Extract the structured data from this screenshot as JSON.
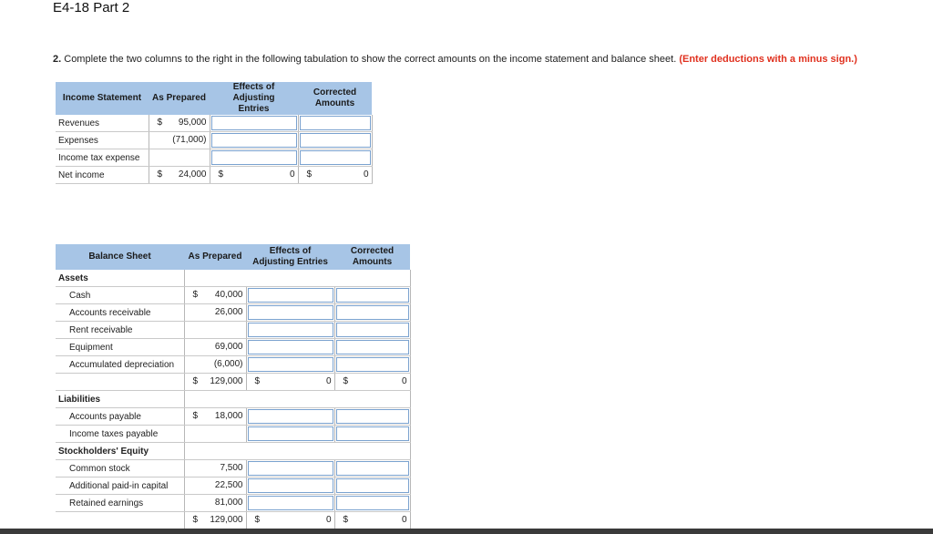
{
  "header": {
    "title": "E4-18 Part 2"
  },
  "instructions": {
    "number": "2.",
    "text": "Complete the two columns to the right in the following tabulation to show the correct amounts on the income statement and balance sheet.",
    "note": "(Enter deductions with a minus sign.)"
  },
  "income_statement": {
    "headers": [
      "Income Statement",
      "As Prepared",
      "Effects of Adjusting Entries",
      "Corrected Amounts"
    ],
    "rows": [
      {
        "label": "Revenues",
        "dollar": "$",
        "amount": "95,000"
      },
      {
        "label": "Expenses",
        "dollar": "",
        "amount": "(71,000)"
      },
      {
        "label": "Income tax expense",
        "dollar": "",
        "amount": ""
      }
    ],
    "total": {
      "label": "Net income",
      "dollar": "$",
      "amount": "24,000",
      "effects_dollar": "$",
      "effects_value": "0",
      "corrected_dollar": "$",
      "corrected_value": "0"
    }
  },
  "balance_sheet": {
    "headers": [
      "Balance Sheet",
      "As Prepared",
      "Effects of Adjusting Entries",
      "Corrected Amounts"
    ],
    "assets_label": "Assets",
    "assets": [
      {
        "label": "Cash",
        "dollar": "$",
        "amount": "40,000"
      },
      {
        "label": "Accounts receivable",
        "dollar": "",
        "amount": "26,000"
      },
      {
        "label": "Rent receivable",
        "dollar": "",
        "amount": ""
      },
      {
        "label": "Equipment",
        "dollar": "",
        "amount": "69,000"
      },
      {
        "label": "Accumulated depreciation",
        "dollar": "",
        "amount": "(6,000)"
      }
    ],
    "assets_total": {
      "dollar": "$",
      "amount": "129,000",
      "effects_dollar": "$",
      "effects_value": "0",
      "corrected_dollar": "$",
      "corrected_value": "0"
    },
    "liabilities_label": "Liabilities",
    "liabilities": [
      {
        "label": "Accounts payable",
        "dollar": "$",
        "amount": "18,000"
      },
      {
        "label": "Income taxes payable",
        "dollar": "",
        "amount": ""
      }
    ],
    "equity_label": "Stockholders' Equity",
    "equity": [
      {
        "label": "Common stock",
        "dollar": "",
        "amount": "7,500"
      },
      {
        "label": "Additional paid-in capital",
        "dollar": "",
        "amount": "22,500"
      },
      {
        "label": "Retained earnings",
        "dollar": "",
        "amount": "81,000"
      }
    ],
    "grand_total": {
      "dollar": "$",
      "amount": "129,000",
      "effects_dollar": "$",
      "effects_value": "0",
      "corrected_dollar": "$",
      "corrected_value": "0"
    }
  }
}
